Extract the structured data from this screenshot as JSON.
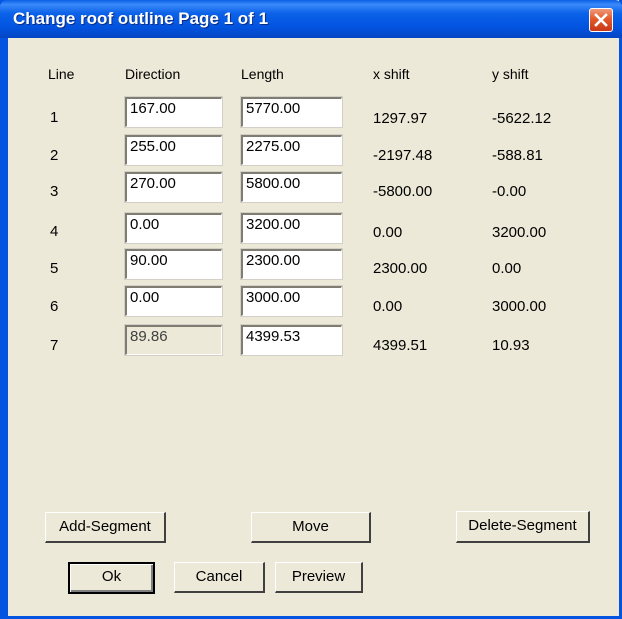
{
  "window": {
    "title": "Change roof outline  Page 1 of 1"
  },
  "headers": {
    "line": "Line",
    "direction": "Direction",
    "length": "Length",
    "xshift": "x shift",
    "yshift": "y shift"
  },
  "rows": [
    {
      "line": "1",
      "direction": "167.00",
      "length": "5770.00",
      "xshift": "1297.97",
      "yshift": "-5622.12"
    },
    {
      "line": "2",
      "direction": "255.00",
      "length": "2275.00",
      "xshift": "-2197.48",
      "yshift": "-588.81"
    },
    {
      "line": "3",
      "direction": "270.00",
      "length": "5800.00",
      "xshift": "-5800.00",
      "yshift": "-0.00"
    },
    {
      "line": "4",
      "direction": "0.00",
      "length": "3200.00",
      "xshift": "0.00",
      "yshift": "3200.00"
    },
    {
      "line": "5",
      "direction": "90.00",
      "length": "2300.00",
      "xshift": "2300.00",
      "yshift": "0.00"
    },
    {
      "line": "6",
      "direction": "0.00",
      "length": "3000.00",
      "xshift": "0.00",
      "yshift": "3000.00"
    },
    {
      "line": "7",
      "direction": "89.86",
      "length": "4399.53",
      "xshift": "4399.51",
      "yshift": "10.93"
    }
  ],
  "buttons": {
    "add_segment": "Add-Segment",
    "move": "Move",
    "delete_segment": "Delete-Segment",
    "ok": "Ok",
    "cancel": "Cancel",
    "preview": "Preview"
  },
  "colors": {
    "titlebar": "#0553e1",
    "face": "#ece9d8",
    "close": "#e35a2a"
  }
}
